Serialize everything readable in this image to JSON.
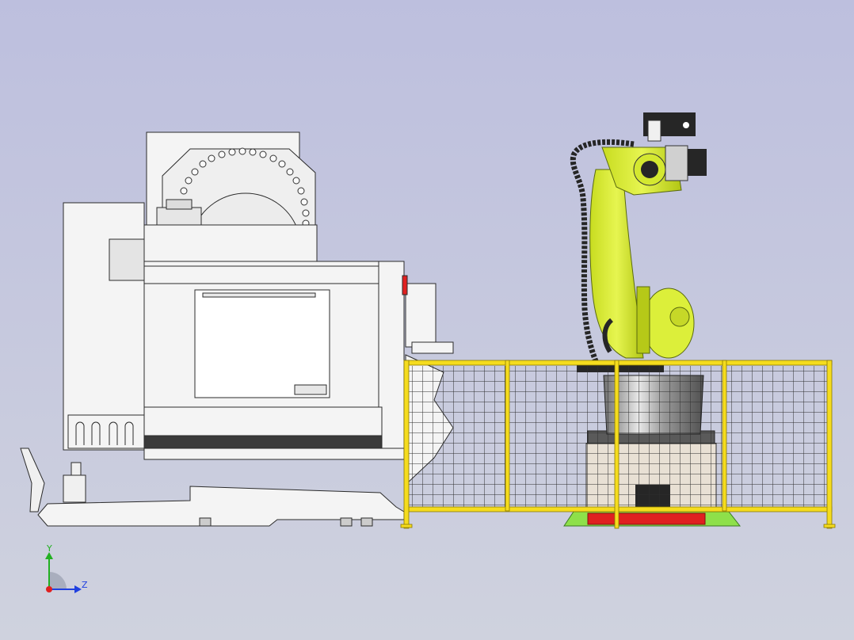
{
  "viewport": {
    "background_top": "#bdbfde",
    "background_bottom": "#cfd2de"
  },
  "colors": {
    "machine_body": "#f4f4f4",
    "machine_line": "#2b2b2b",
    "machine_dark_band": "#3a3a3a",
    "robot_yellow": "#dcef3a",
    "robot_yellow_shade": "#b6c918",
    "robot_dark": "#262626",
    "fence_yellow": "#f5dc1e",
    "fence_mesh": "#2d2d2d",
    "base_green": "#8ee04a",
    "base_red": "#e02020",
    "axis_y": "#22b022",
    "axis_z": "#2040e0",
    "axis_origin": "#e02020"
  },
  "triad": {
    "y_label": "Y",
    "z_label": "Z"
  }
}
